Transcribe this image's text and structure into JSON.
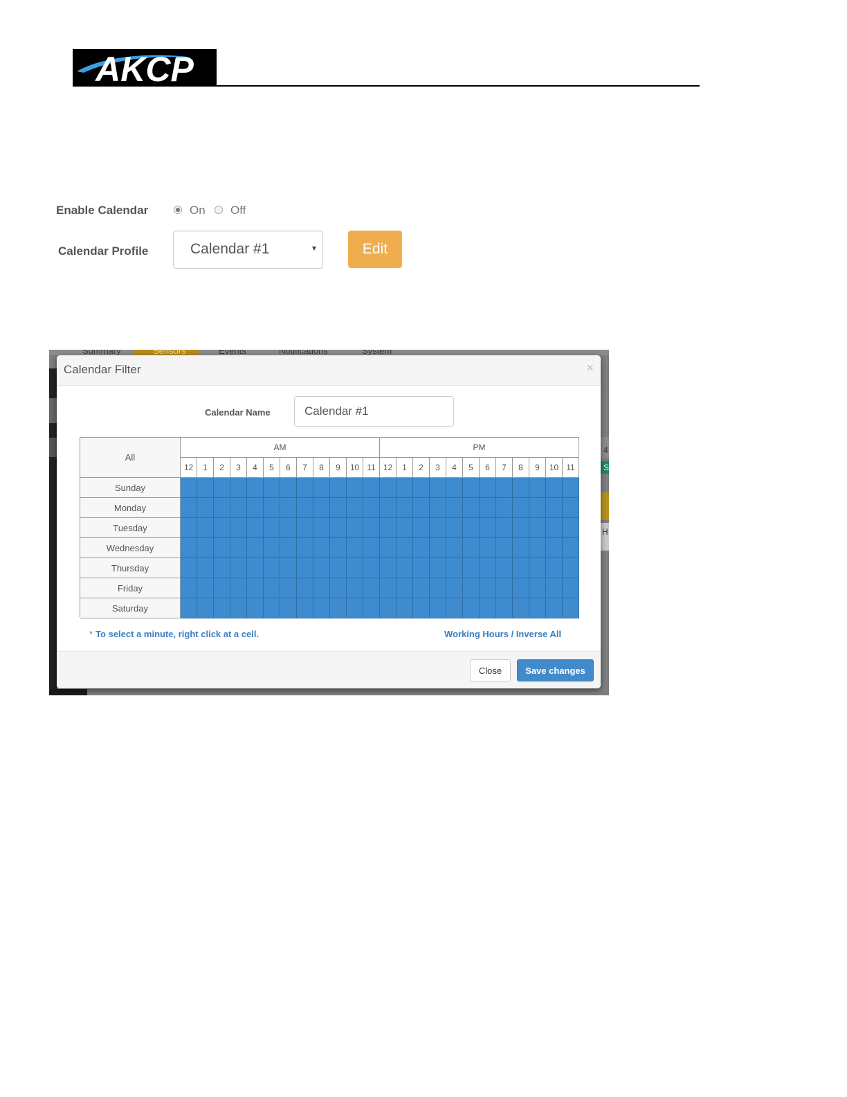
{
  "header": {
    "logo_text": "AKCP"
  },
  "settings": {
    "enable_calendar_label": "Enable Calendar",
    "radio_on": "On",
    "radio_off": "Off",
    "radio_selected": "On",
    "calendar_profile_label": "Calendar Profile",
    "calendar_profile_value": "Calendar #1",
    "edit_button": "Edit"
  },
  "background_tabs": [
    "Summary",
    "Sensors",
    "Events",
    "Notifications",
    "System"
  ],
  "background_fragments": {
    "right_top": "4",
    "right_green": "S",
    "right_mid": "H"
  },
  "modal": {
    "title": "Calendar Filter",
    "close_symbol": "×",
    "calendar_name_label": "Calendar Name",
    "calendar_name_value": "Calendar #1",
    "grid": {
      "all_label": "All",
      "am_label": "AM",
      "pm_label": "PM",
      "hours": [
        "12",
        "1",
        "2",
        "3",
        "4",
        "5",
        "6",
        "7",
        "8",
        "9",
        "10",
        "11",
        "12",
        "1",
        "2",
        "3",
        "4",
        "5",
        "6",
        "7",
        "8",
        "9",
        "10",
        "11"
      ],
      "days": [
        "Sunday",
        "Monday",
        "Tuesday",
        "Wednesday",
        "Thursday",
        "Friday",
        "Saturday"
      ],
      "all_cells_selected": true,
      "selected_color": "#3e8bcf"
    },
    "note_star": "*",
    "note_text": "To select a minute, right click at a cell.",
    "working_hours_link": "Working Hours",
    "link_separator": "/",
    "inverse_all_link": "Inverse All",
    "close_button": "Close",
    "save_button": "Save changes"
  }
}
